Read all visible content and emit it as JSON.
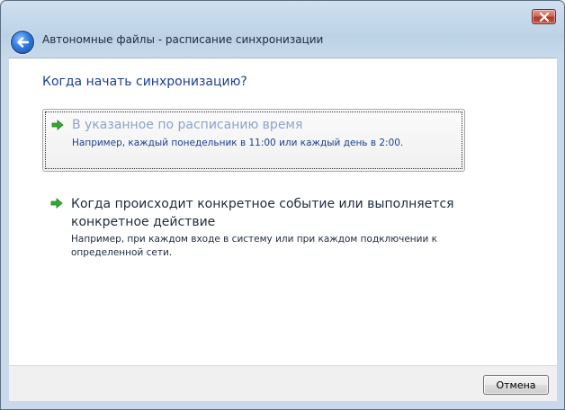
{
  "window": {
    "title": "Автономные файлы - расписание синхронизации"
  },
  "icons": {
    "back": "back-arrow-icon",
    "close": "close-icon",
    "option_arrow": "green-arrow-icon"
  },
  "heading": "Когда начать синхронизацию?",
  "options": [
    {
      "title": "В указанное по расписанию время",
      "description": "Например, каждый понедельник в 11:00 или каждый день в 2:00."
    },
    {
      "title": "Когда происходит конкретное событие или выполняется конкретное действие",
      "description": "Например, при каждом входе в систему или при каждом подключении к определенной сети."
    }
  ],
  "footer": {
    "cancel_label": "Отмена"
  },
  "colors": {
    "accent_text": "#1d3f8f",
    "arrow_green": "#2e9e2e",
    "close_red": "#c9533f"
  }
}
